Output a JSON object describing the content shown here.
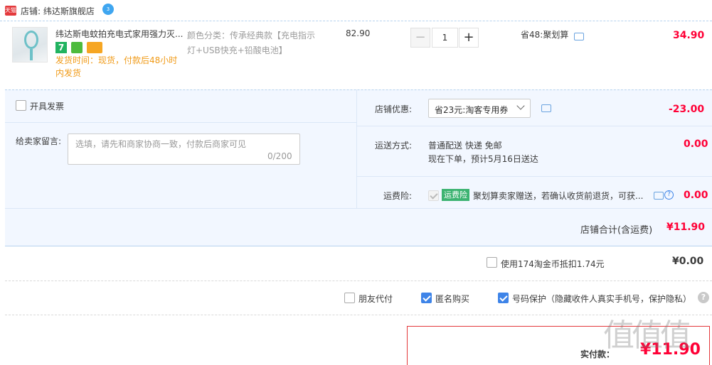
{
  "shop": {
    "tag": "天猫",
    "label": "店铺: 纬达斯旗舰店",
    "wangwang_badge": "3"
  },
  "item": {
    "title": "纬达斯电蚊拍充电式家用强力灭...",
    "badge_seven": "7",
    "ship_time": "发货时间：现货，付款后48小时内发货",
    "sku": "颜色分类：传承经典款【充电指示灯+USB快充+铅酸电池】",
    "unit_price": "82.90",
    "qty_minus": "−",
    "qty": "1",
    "qty_plus": "+",
    "promo": "省48:聚划算",
    "total": "34.90"
  },
  "invoice": {
    "label": "开具发票"
  },
  "message": {
    "label": "给卖家留言:",
    "placeholder": "选填，请先和商家协商一致，付款后商家可见",
    "count": "0/200"
  },
  "discount": {
    "label": "店铺优惠:",
    "selected": "省23元:淘客专用券",
    "value": "-23.00"
  },
  "shipping": {
    "label": "运送方式:",
    "method": "普通配送 快递 免邮",
    "eta": "现在下单，预计5月16日送达",
    "value": "0.00"
  },
  "insurance": {
    "label": "运费险:",
    "tag": "运费险",
    "text": "聚划算卖家赠送，若确认收货前退货，可获...",
    "help": "?",
    "value": "0.00"
  },
  "shop_total": {
    "label": "店铺合计(含运费)",
    "value": "¥11.90"
  },
  "coins": {
    "label": "使用174淘金币抵扣1.74元",
    "value": "¥0.00"
  },
  "options": {
    "friend_pay": "朋友代付",
    "anonymous": "匿名购买",
    "number_protect": "号码保护（隐藏收件人真实手机号，保护隐私）",
    "help": "?"
  },
  "final": {
    "label": "实付款：",
    "value": "¥11.90"
  },
  "watermark": "值值值",
  "colors": {
    "accent_blue": "#3e84e8",
    "price_red": "#ff0036",
    "ship_orange": "#f09a17",
    "panel_bg": "#f2f7ff",
    "tag_green": "#3cb371"
  }
}
